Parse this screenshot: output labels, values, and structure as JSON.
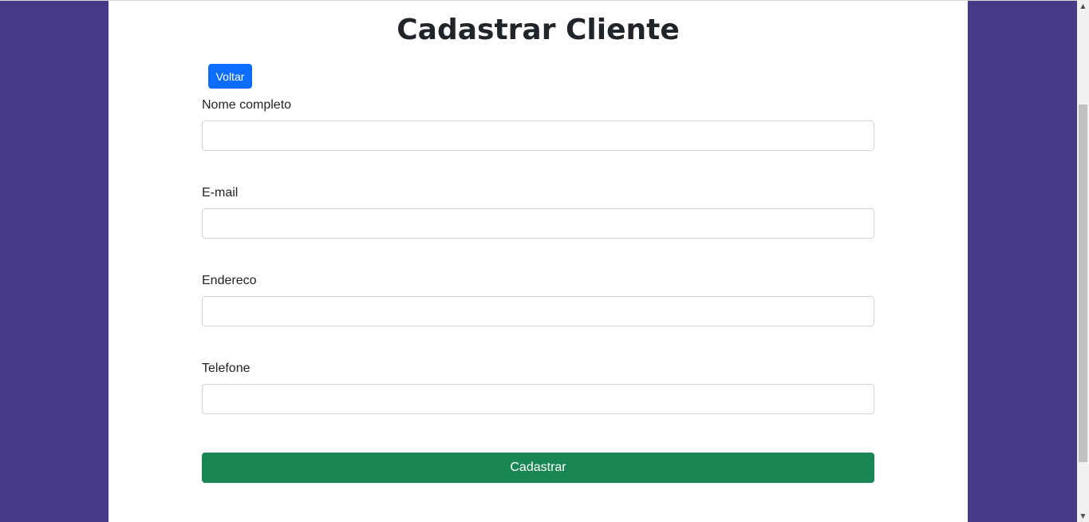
{
  "page": {
    "title": "Cadastrar Cliente",
    "back_label": "Voltar"
  },
  "form": {
    "fields": [
      {
        "label": "Nome completo",
        "value": "",
        "placeholder": ""
      },
      {
        "label": "E-mail",
        "value": "",
        "placeholder": ""
      },
      {
        "label": "Endereco",
        "value": "",
        "placeholder": ""
      },
      {
        "label": "Telefone",
        "value": "",
        "placeholder": ""
      }
    ],
    "submit_label": "Cadastrar"
  },
  "colors": {
    "background": "#473b87",
    "panel": "#ffffff",
    "back_button": "#0d6efd",
    "submit_button": "#198754"
  },
  "icons": {
    "scroll_up": "scroll-up-arrow-icon",
    "scroll_down": "scroll-down-arrow-icon"
  }
}
